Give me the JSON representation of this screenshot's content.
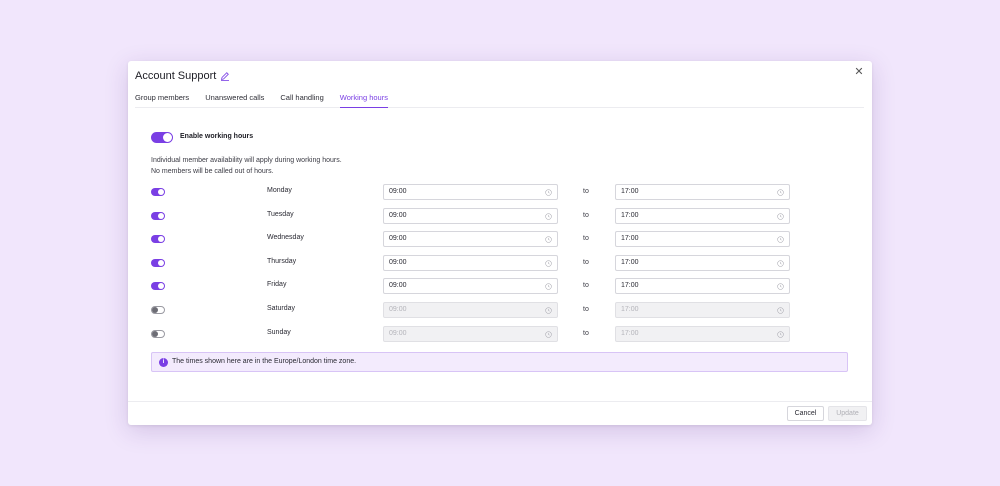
{
  "modal": {
    "title": "Account Support",
    "close_glyph": "✕"
  },
  "tabs": [
    {
      "label": "Group members",
      "active": false
    },
    {
      "label": "Unanswered calls",
      "active": false
    },
    {
      "label": "Call handling",
      "active": false
    },
    {
      "label": "Working hours",
      "active": true
    }
  ],
  "working_hours": {
    "enabled": true,
    "enable_label": "Enable working hours",
    "note_line1": "Individual member availability will apply during working hours.",
    "note_line2": "No members will be called out of hours.",
    "to_label": "to",
    "days": [
      {
        "name": "Monday",
        "enabled": true,
        "start": "09:00",
        "end": "17:00"
      },
      {
        "name": "Tuesday",
        "enabled": true,
        "start": "09:00",
        "end": "17:00"
      },
      {
        "name": "Wednesday",
        "enabled": true,
        "start": "09:00",
        "end": "17:00"
      },
      {
        "name": "Thursday",
        "enabled": true,
        "start": "09:00",
        "end": "17:00"
      },
      {
        "name": "Friday",
        "enabled": true,
        "start": "09:00",
        "end": "17:00"
      },
      {
        "name": "Saturday",
        "enabled": false,
        "start": "09:00",
        "end": "17:00"
      },
      {
        "name": "Sunday",
        "enabled": false,
        "start": "09:00",
        "end": "17:00"
      }
    ],
    "timezone_note": "The times shown here are in the Europe/London time zone.",
    "info_glyph": "i"
  },
  "footer": {
    "cancel_label": "Cancel",
    "update_label": "Update",
    "update_enabled": false
  },
  "colors": {
    "accent": "#7a3fe4",
    "page_background": "#f1e6fc",
    "info_background": "#f3ebfd"
  },
  "icons": [
    "pencil-icon",
    "close-icon",
    "clock-icon",
    "info-icon"
  ]
}
